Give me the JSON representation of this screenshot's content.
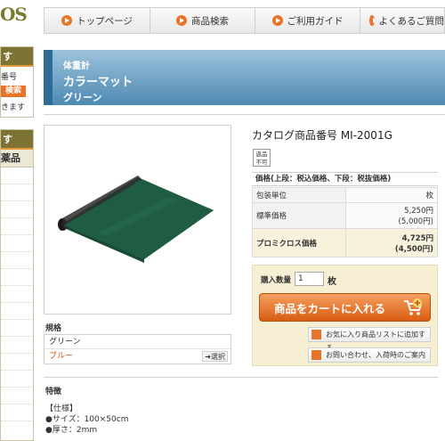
{
  "logo": {
    "text": "OS"
  },
  "nav": [
    {
      "label": "トップページ"
    },
    {
      "label": "商品検索"
    },
    {
      "label": "ご利用ガイド"
    },
    {
      "label": "よくあるご質問"
    }
  ],
  "sidebar": {
    "box1_head": "す",
    "box1_text1": "番号",
    "box1_button": "検索",
    "box1_text2": "きます",
    "box2_head": "す",
    "box2_sub": "薬品"
  },
  "title": {
    "category": "体重計",
    "name": "カラーマット",
    "color": "グリーン"
  },
  "spec": {
    "label": "規格",
    "options": [
      "グリーン",
      "ブルー"
    ],
    "select_label": "選択"
  },
  "product": {
    "catalog_no": "カタログ商品番号  MI-2001G",
    "badge": [
      "返品",
      "不可"
    ],
    "price_header": "価格(上段：税込価格、下段：税抜価格)",
    "rows": [
      {
        "label": "包装単位",
        "value": "枚",
        "value2": ""
      },
      {
        "label": "標準価格",
        "value": "5,250円",
        "value2": "(5,000円)"
      },
      {
        "label": "プロミクロス価格",
        "value": "4,725円",
        "value2": "(4,500円)"
      }
    ]
  },
  "cart": {
    "qty_label": "購入数量",
    "qty_value": "1",
    "qty_unit": "枚",
    "add_button": "商品をカートに入れる",
    "favorite_button": "お気に入り商品リストに追加する",
    "inquiry_button": "お問い合わせ、入荷時のご案内"
  },
  "features": {
    "title": "特徴",
    "lines": [
      "【仕様】",
      "●サイズ：100×50cm",
      "●厚さ：2mm"
    ]
  },
  "colors": {
    "accent": "#e8742a",
    "title_bar": "#4f8ab3",
    "mat_green": "#1f5d43"
  }
}
